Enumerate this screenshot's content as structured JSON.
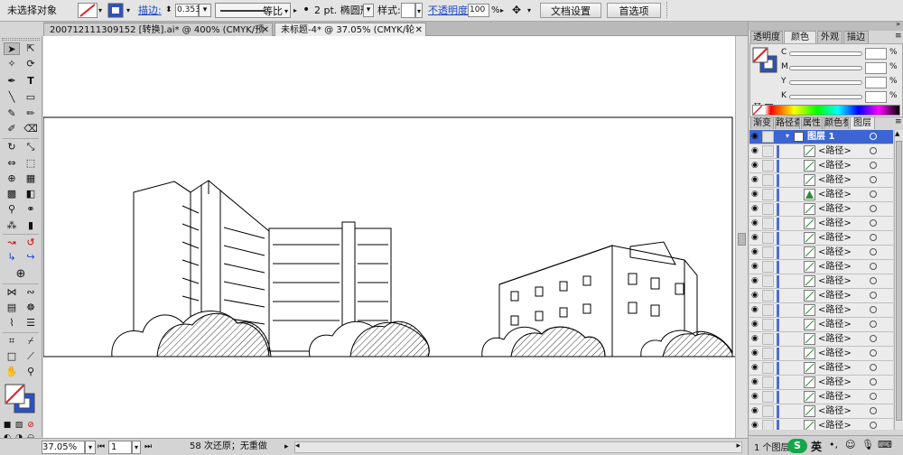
{
  "control_bar": {
    "selection_status": "未选择对象",
    "stroke_label": "描边:",
    "stroke_weight": "0.353",
    "profile_label": "等比",
    "brush_label": "2 pt. 椭圆形",
    "style_label": "样式:",
    "opacity_label": "不透明度:",
    "opacity_value": "100",
    "opacity_unit": "%",
    "document_setup": "文档设置",
    "preferences": "首选项"
  },
  "doc_tabs": [
    {
      "label": "200712111309152 [转换].ai* @ 400% (CMYK/预览)",
      "active": false
    },
    {
      "label": "未标题-4* @ 37.05% (CMYK/轮廓)",
      "active": true
    }
  ],
  "color_panel": {
    "tabs": [
      "透明度",
      "颜色",
      "外观",
      "描边"
    ],
    "active_tab": "颜色",
    "channels": [
      "C",
      "M",
      "Y",
      "K"
    ],
    "percent": "%"
  },
  "layers_panel": {
    "tabs": [
      "渐变",
      "路径查",
      "属性",
      "颜色参",
      "图层"
    ],
    "active_tab": "图层",
    "layer_name": "图层 1",
    "items": [
      "<路径>",
      "<路径>",
      "<路径>",
      "<路径>",
      "<路径>",
      "<路径>",
      "<路径>",
      "<路径>",
      "<路径>",
      "<路径>",
      "<路径>",
      "<路径>",
      "<路径>",
      "<路径>",
      "<路径>",
      "<路径>",
      "<路径>",
      "<路径>",
      "<路径>",
      "<路径>"
    ],
    "footer": "1 个图层"
  },
  "status_bar": {
    "zoom": "37.05%",
    "artboard": "1",
    "history": "58 次还原；无重做"
  },
  "ime": {
    "label": "英"
  },
  "colors": {
    "layer_highlight": "#3c64d2",
    "link_blue": "#1a48c8"
  }
}
